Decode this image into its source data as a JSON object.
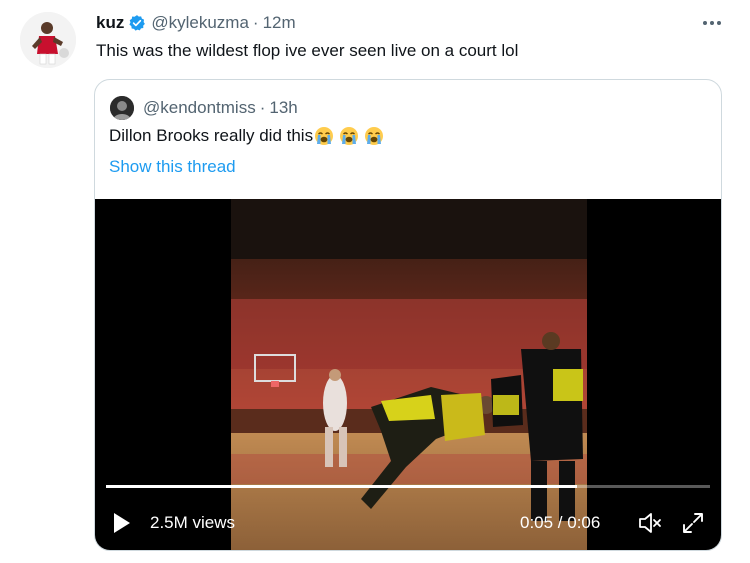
{
  "tweet": {
    "display_name": "kuz",
    "handle": "@kylekuzma",
    "separator": "·",
    "time": "12m",
    "text": "This was the wildest flop ive ever seen live on a court lol",
    "avatar_icon": "player-avatar",
    "verified_icon": "verified-badge-icon",
    "more_icon": "more-options-icon"
  },
  "quoted": {
    "handle": "@kendontmiss",
    "separator": "·",
    "time": "13h",
    "text": "Dillon Brooks really did this",
    "emojis": [
      "loudly-crying-face-emoji",
      "loudly-crying-face-emoji",
      "loudly-crying-face-emoji"
    ],
    "show_thread": "Show this thread",
    "avatar_icon": "user-avatar"
  },
  "video": {
    "views": "2.5M views",
    "time": "0:05 / 0:06",
    "progress": 0.78,
    "play_icon": "play-icon",
    "volume_icon": "volume-muted-icon",
    "fullscreen_icon": "expand-icon"
  },
  "colors": {
    "text": "#0f1419",
    "muted": "#536471",
    "link": "#1d9bf0",
    "verified": "#1d9bf0",
    "border": "#cfd9de",
    "video_bg": "#000000"
  }
}
